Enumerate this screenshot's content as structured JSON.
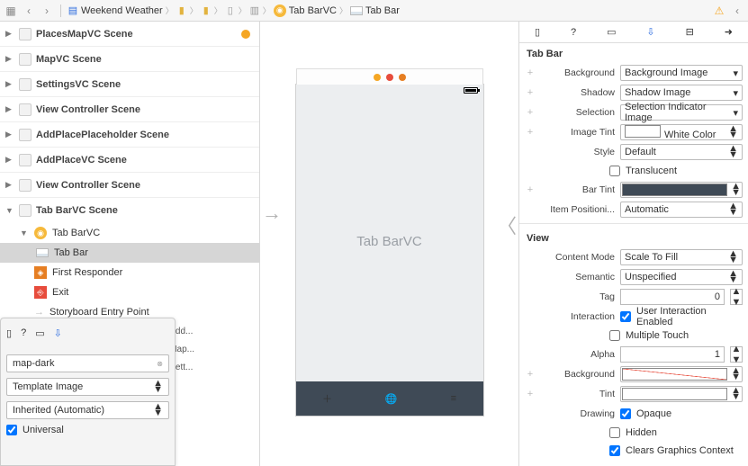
{
  "breadcrumb": {
    "project": "Weekend Weather",
    "vc": "Tab BarVC",
    "item": "Tab Bar"
  },
  "outline": {
    "scenes": [
      "PlacesMapVC Scene",
      "MapVC Scene",
      "SettingsVC Scene",
      "View Controller Scene",
      "AddPlacePlaceholder Scene",
      "AddPlaceVC Scene",
      "View Controller Scene",
      "Tab BarVC Scene"
    ],
    "tabscene": {
      "vc": "Tab BarVC",
      "tab": "Tab Bar",
      "responder": "First Responder",
      "exit": "Exit",
      "entry": "Storyboard Entry Point"
    },
    "segues": [
      "rollers\" to \"Add...",
      "rollers\" to \"Map...",
      "rollers\" to \"Sett..."
    ]
  },
  "popover": {
    "name": "map-dark",
    "render": "Template Image",
    "inherit": "Inherited (Automatic)",
    "universal": "Universal"
  },
  "device": {
    "label": "Tab BarVC"
  },
  "inspector": {
    "section1": "Tab Bar",
    "background": {
      "label": "Background",
      "value": "Background Image"
    },
    "shadow": {
      "label": "Shadow",
      "value": "Shadow Image"
    },
    "selection": {
      "label": "Selection",
      "value": "Selection Indicator Image"
    },
    "imageTint": {
      "label": "Image Tint",
      "value": "White Color"
    },
    "style": {
      "label": "Style",
      "value": "Default"
    },
    "translucent": "Translucent",
    "barTint": {
      "label": "Bar Tint"
    },
    "itemPos": {
      "label": "Item Positioni...",
      "value": "Automatic"
    },
    "section2": "View",
    "contentMode": {
      "label": "Content Mode",
      "value": "Scale To Fill"
    },
    "semantic": {
      "label": "Semantic",
      "value": "Unspecified"
    },
    "tag": {
      "label": "Tag",
      "value": "0"
    },
    "interaction": {
      "label": "Interaction",
      "uie": "User Interaction Enabled",
      "mt": "Multiple Touch"
    },
    "alpha": {
      "label": "Alpha",
      "value": "1"
    },
    "background2": {
      "label": "Background"
    },
    "tint": {
      "label": "Tint"
    },
    "drawing": {
      "label": "Drawing",
      "opaque": "Opaque",
      "hidden": "Hidden",
      "clears": "Clears Graphics Context"
    }
  }
}
